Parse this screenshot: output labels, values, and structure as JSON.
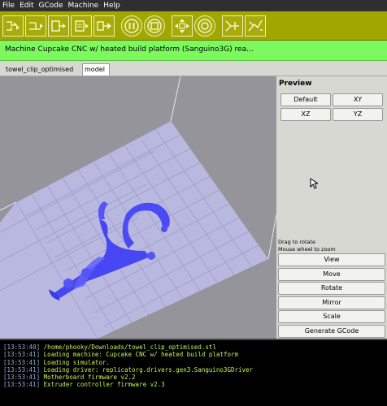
{
  "menu": [
    "File",
    "Edit",
    "GCode",
    "Machine",
    "Help"
  ],
  "toolbar": {
    "buttons": [
      "connect-icon",
      "reset-icon",
      "upload-icon",
      "build-icon",
      "build-to-file-icon",
      "pause-icon",
      "stop-icon",
      "jog-control-icon",
      "rotate-icon",
      "toggle-machine-icon",
      "toggle-relay-icon"
    ]
  },
  "status": {
    "text": "Machine Cupcake CNC w/ heated build platform (Sanguino3G) rea..."
  },
  "tabs": [
    {
      "label": "towel_clip_optimised",
      "active": false
    },
    {
      "label": "model",
      "active": true
    }
  ],
  "preview": {
    "title": "Preview",
    "buttons": {
      "default": "Default",
      "xy": "XY",
      "xz": "XZ",
      "yz": "YZ"
    },
    "help_rotate": "Drag to rotate",
    "help_zoom": "Mouse wheel to zoom"
  },
  "actions": {
    "view": "View",
    "move": "Move",
    "rotate": "Rotate",
    "mirror": "Mirror",
    "scale": "Scale",
    "generate": "Generate GCode"
  },
  "console": [
    {
      "time": "[13:53:40]",
      "msg": " /home/phooky/Downloads/towel_clip_optimised.stl"
    },
    {
      "time": "[13:53:41]",
      "msg": " Loading machine: Cupcake CNC w/ heated build platform"
    },
    {
      "time": "[13:53:41]",
      "msg": " Loading simulator."
    },
    {
      "time": "[13:53:41]",
      "msg": " Loading driver: replicatorg.drivers.gen3.Sanguino3GDriver"
    },
    {
      "time": "[13:53:41]",
      "msg": " Motherboard firmware v2.2"
    },
    {
      "time": "[13:53:41]",
      "msg": " Extruder controller firmware v2.3"
    }
  ],
  "colors": {
    "toolbar": "#a2a600",
    "status": "#7cf95e",
    "viewport": "#95949b",
    "platform": "#b9b8df",
    "model": "#5050f5",
    "console_time": "#8fb0d6",
    "console_text": "#c4f05a"
  }
}
